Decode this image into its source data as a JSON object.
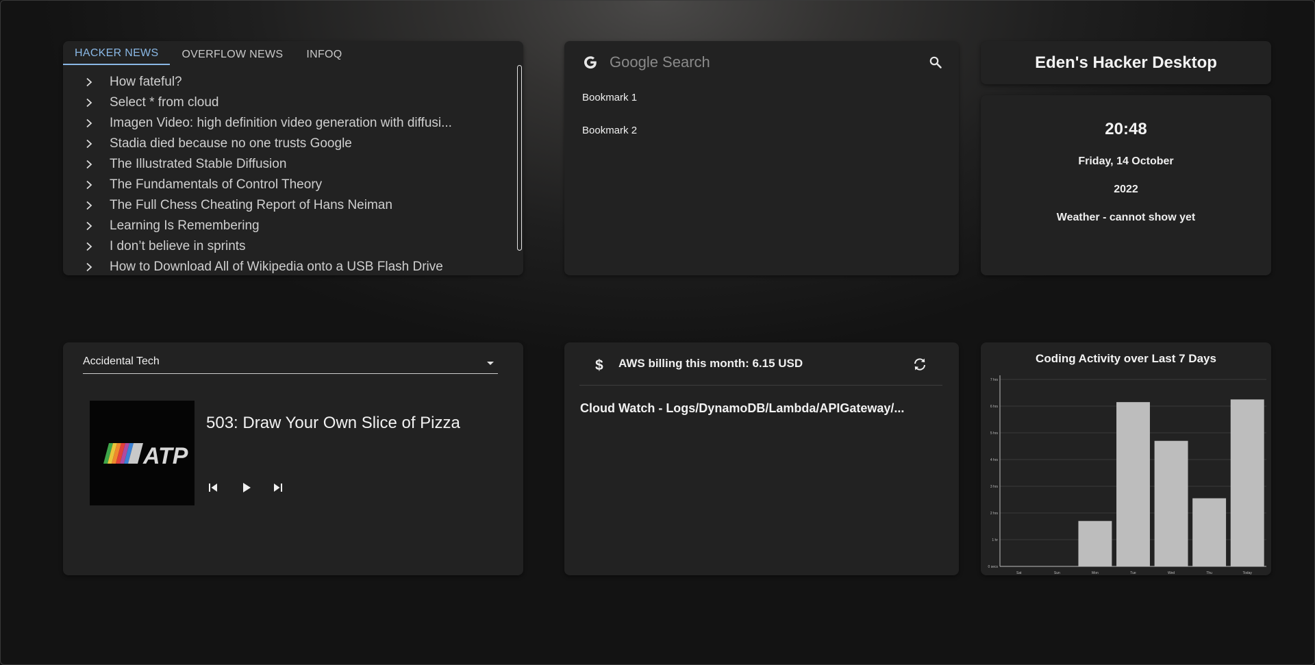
{
  "news": {
    "tabs": [
      {
        "label": "HACKER NEWS",
        "active": true
      },
      {
        "label": "OVERFLOW NEWS",
        "active": false
      },
      {
        "label": "INFOQ",
        "active": false
      }
    ],
    "items": [
      "How fateful?",
      "Select * from cloud",
      "Imagen Video: high definition video generation with diffusi...",
      "Stadia died because no one trusts Google",
      "The Illustrated Stable Diffusion",
      "The Fundamentals of Control Theory",
      "The Full Chess Cheating Report of Hans Neiman",
      "Learning Is Remembering",
      "I don’t believe in sprints",
      "How to Download All of Wikipedia onto a USB Flash Drive"
    ]
  },
  "search": {
    "placeholder": "Google Search",
    "bookmarks": [
      "Bookmark 1",
      "Bookmark 2"
    ]
  },
  "desktop_title": "Eden's Hacker Desktop",
  "clock": {
    "time": "20:48",
    "date": "Friday, 14 October",
    "year": "2022",
    "weather": "Weather - cannot show yet"
  },
  "podcast": {
    "selected": "Accidental Tech",
    "episode_title": "503: Draw Your Own Slice of Pizza",
    "artwork_text": "ATP"
  },
  "aws": {
    "billing_label": "AWS billing this month: 6.15 USD",
    "cloudwatch_title": "Cloud Watch - Logs/DynamoDB/Lambda/APIGateway/..."
  },
  "chart_data": {
    "type": "bar",
    "title": "Coding Activity over Last 7 Days",
    "categories": [
      "Sat",
      "Sun",
      "Mon",
      "Tue",
      "Wed",
      "Thu",
      "Today"
    ],
    "values": [
      0,
      0,
      1.7,
      6.15,
      4.7,
      2.55,
      6.25
    ],
    "ytick_labels": [
      "0 secs",
      "1 hr",
      "2 hrs",
      "3 hrs",
      "4 hrs",
      "5 hrs",
      "6 hrs",
      "7 hrs"
    ],
    "ylim": [
      0,
      7
    ],
    "bar_color": "#bdbdbd",
    "grid": true,
    "legend": "none"
  },
  "colors": {
    "accent": "#8ab8e6",
    "card": "#222222"
  }
}
